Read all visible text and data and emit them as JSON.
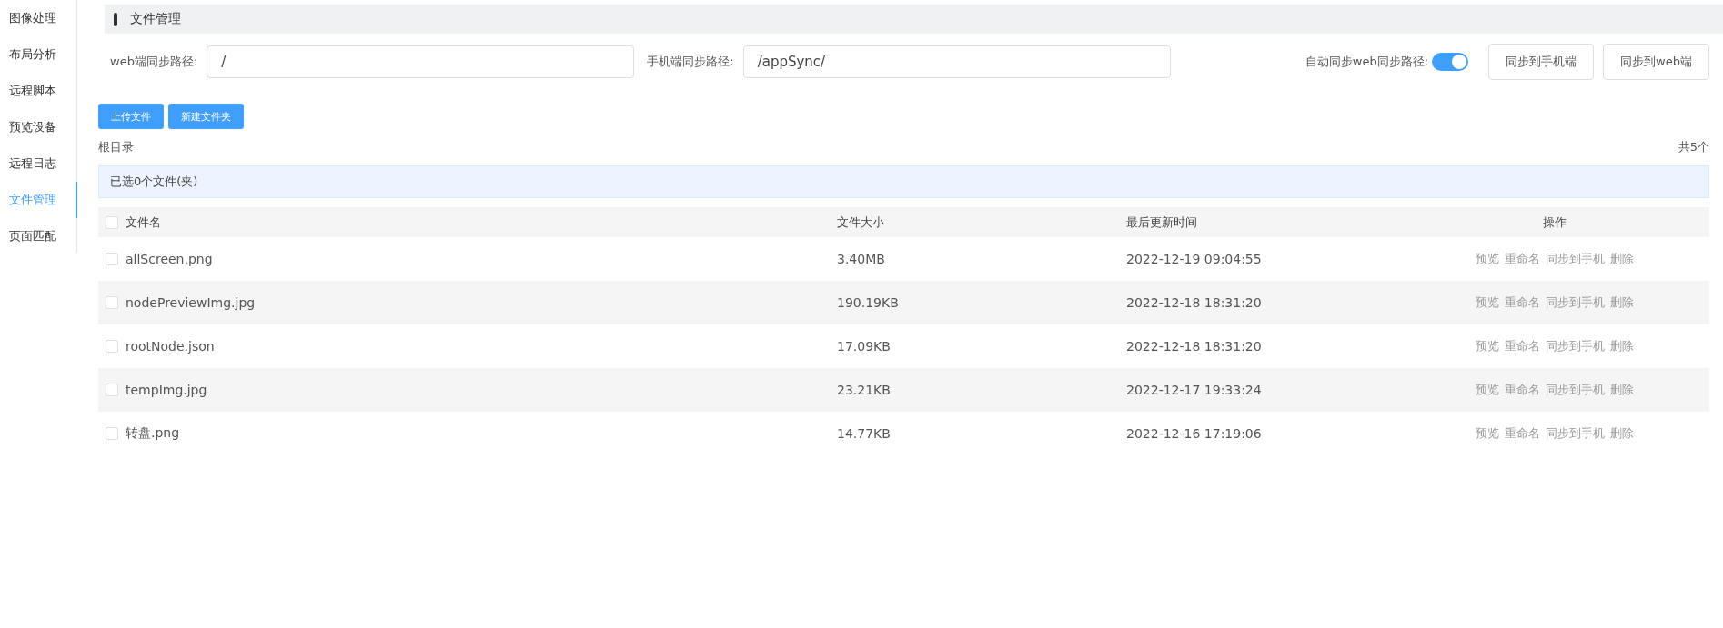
{
  "sidebar": {
    "items": [
      {
        "label": "图像处理",
        "selected": false
      },
      {
        "label": "布局分析",
        "selected": false
      },
      {
        "label": "远程脚本",
        "selected": false
      },
      {
        "label": "预览设备",
        "selected": false
      },
      {
        "label": "远程日志",
        "selected": false
      },
      {
        "label": "文件管理",
        "selected": true
      },
      {
        "label": "页面匹配",
        "selected": false
      }
    ]
  },
  "header": {
    "title": "文件管理"
  },
  "sync": {
    "web_path": {
      "label": "web端同步路径:",
      "value": "/"
    },
    "mobile_path": {
      "label": "手机端同步路径:",
      "value": "/appSync/"
    },
    "auto_sync": {
      "label": "自动同步web同步路径:",
      "on": true
    },
    "buttons": [
      "同步到手机端",
      "同步到web端"
    ]
  },
  "actions": [
    "上传文件",
    "新建文件夹"
  ],
  "breadcrumb": "根目录",
  "total": "共5个",
  "selection_info": "已选0个文件(夹)",
  "table": {
    "columns": [
      "文件名",
      "文件大小",
      "最后更新时间",
      "操作"
    ],
    "all_checked": false,
    "rows": [
      {
        "name": "allScreen.png",
        "size": "3.40MB",
        "time": "2022-12-19 09:04:55",
        "checked": false,
        "ops": [
          "预览",
          "重命名",
          "同步到手机",
          "删除"
        ]
      },
      {
        "name": "nodePreviewImg.jpg",
        "size": "190.19KB",
        "time": "2022-12-18 18:31:20",
        "checked": false,
        "ops": [
          "预览",
          "重命名",
          "同步到手机",
          "删除"
        ]
      },
      {
        "name": "rootNode.json",
        "size": "17.09KB",
        "time": "2022-12-18 18:31:20",
        "checked": false,
        "ops": [
          "预览",
          "重命名",
          "同步到手机",
          "删除"
        ]
      },
      {
        "name": "tempImg.jpg",
        "size": "23.21KB",
        "time": "2022-12-17 19:33:24",
        "checked": false,
        "ops": [
          "预览",
          "重命名",
          "同步到手机",
          "删除"
        ]
      },
      {
        "name": "转盘.png",
        "size": "14.77KB",
        "time": "2022-12-16 17:19:06",
        "checked": false,
        "ops": [
          "预览",
          "重命名",
          "同步到手机",
          "删除"
        ]
      }
    ]
  }
}
